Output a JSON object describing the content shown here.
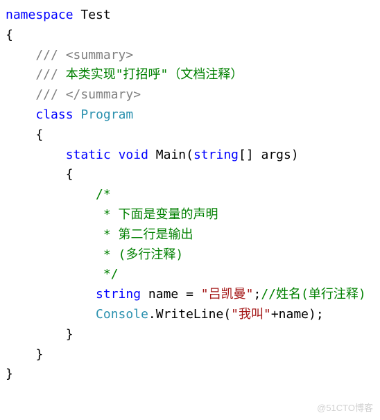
{
  "code": {
    "line1_kw_namespace": "namespace",
    "line1_name": " Test",
    "line2": "{",
    "line3_doc": "    /// <summary>",
    "line4_doc_prefix": "    /// ",
    "line4_doc_text": "本类实现\"打招呼\"（文档注释）",
    "line5_doc": "    /// </summary>",
    "line6_indent": "    ",
    "line6_kw_class": "class",
    "line6_space": " ",
    "line6_type": "Program",
    "line7": "    {",
    "line8_indent": "        ",
    "line8_kw_static": "static",
    "line8_sp1": " ",
    "line8_kw_void": "void",
    "line8_sp2": " ",
    "line8_main": "Main(",
    "line8_kw_string": "string",
    "line8_args": "[] args)",
    "line9": "        {",
    "line10_comm": "            /*",
    "line11_comm": "             * 下面是变量的声明",
    "line12_comm": "             * 第二行是输出",
    "line13_comm": "             * (多行注释)",
    "line14_comm": "             */",
    "line15_indent": "            ",
    "line15_kw_string": "string",
    "line15_txt1": " name = ",
    "line15_str": "\"吕凯曼\"",
    "line15_txt2": ";",
    "line15_comm": "//姓名(单行注释)",
    "line16_indent": "            ",
    "line16_console": "Console",
    "line16_txt1": ".WriteLine(",
    "line16_str": "\"我叫\"",
    "line16_txt2": "+name);",
    "line17": "        }",
    "line18": "    }",
    "line19": "}"
  },
  "watermark": "@51CTO博客"
}
